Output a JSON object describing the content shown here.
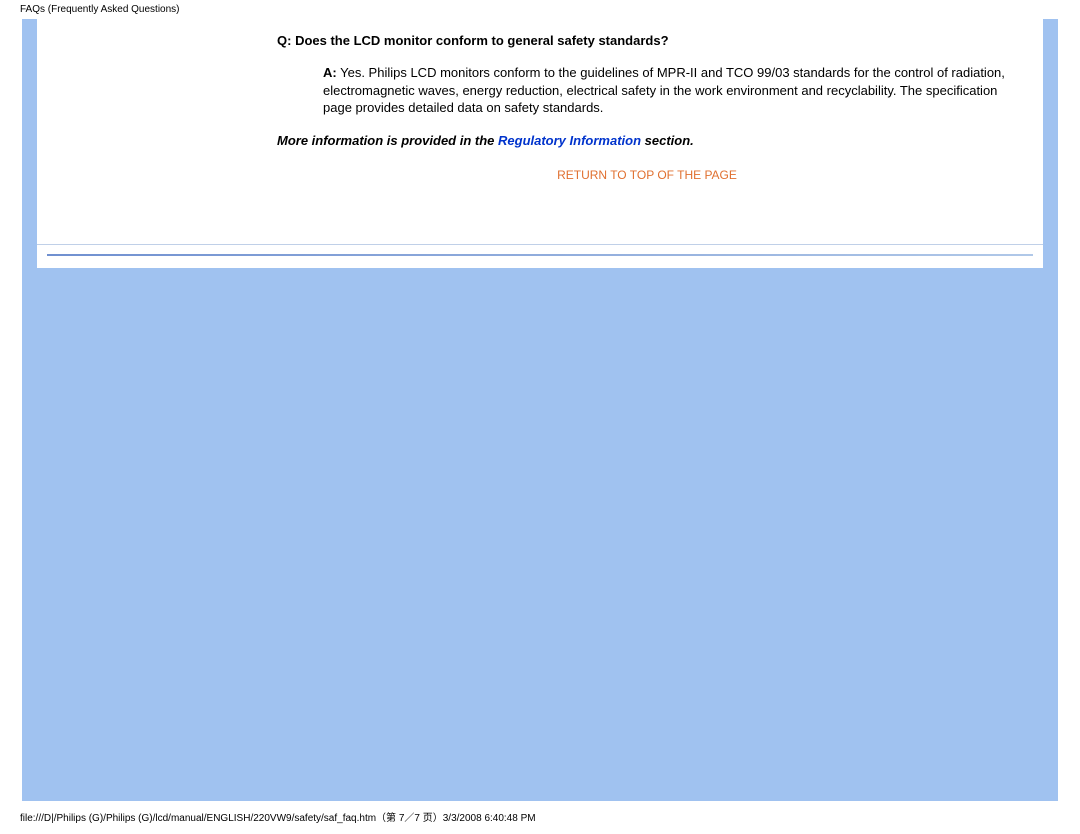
{
  "header": {
    "title": "FAQs (Frequently Asked Questions)"
  },
  "faq": {
    "q_prefix": "Q:",
    "question": "Does the LCD monitor conform to general safety standards?",
    "a_prefix": "A:",
    "answer": "Yes. Philips LCD monitors conform to the guidelines of MPR-II and TCO 99/03 standards for the control of radiation, electromagnetic waves, energy reduction, electrical safety in the work environment and recyclability. The specification page provides detailed data on safety standards."
  },
  "more_info": {
    "prefix": "More information is provided in the ",
    "link_text": "Regulatory Information",
    "suffix": " section."
  },
  "nav": {
    "return_top": "RETURN TO TOP OF THE PAGE"
  },
  "footer": {
    "path": "file:///D|/Philips (G)/Philips (G)/lcd/manual/ENGLISH/220VW9/safety/saf_faq.htm（第 7／7 页）3/3/2008 6:40:48 PM"
  }
}
